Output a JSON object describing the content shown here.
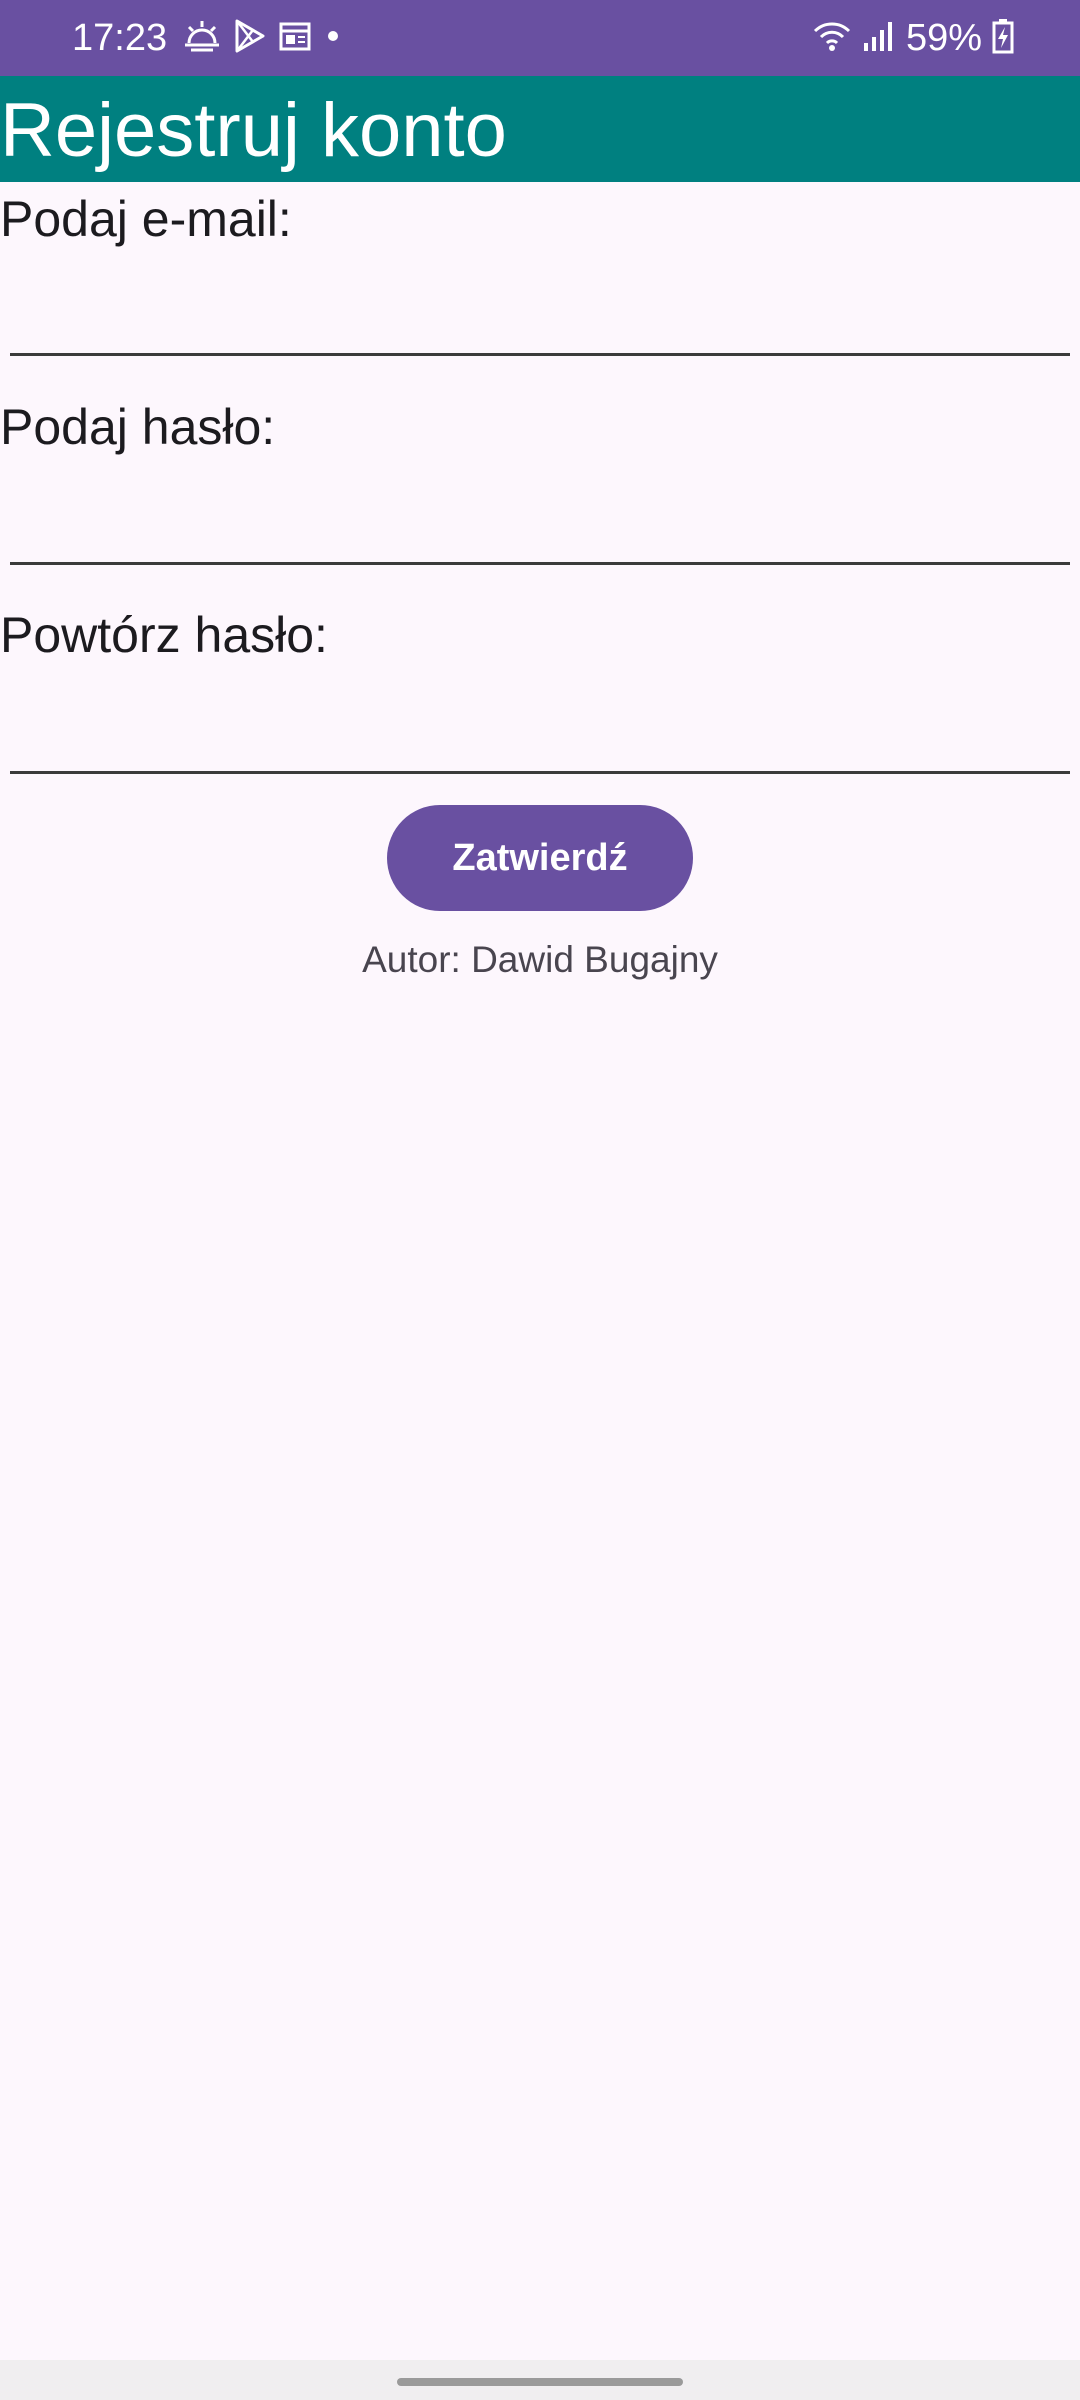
{
  "status_bar": {
    "time": "17:23",
    "battery": "59%",
    "left_icons": [
      "weather-sunrise-icon",
      "play-store-icon",
      "calendar-icon",
      "dot-icon"
    ],
    "right_icons": [
      "wifi-icon",
      "signal-icon",
      "battery-charging-icon"
    ],
    "color": "#6950a1"
  },
  "app_bar": {
    "title": "Rejestruj konto",
    "color": "#008080"
  },
  "form": {
    "email_label": "Podaj e-mail:",
    "email_value": "",
    "password_label": "Podaj hasło:",
    "password_value": "",
    "repeat_password_label": "Powtórz hasło:",
    "repeat_password_value": "",
    "submit_label": "Zatwierdź",
    "accent_color": "#6950a1"
  },
  "footer": {
    "author": "Autor: Dawid Bugajny"
  }
}
